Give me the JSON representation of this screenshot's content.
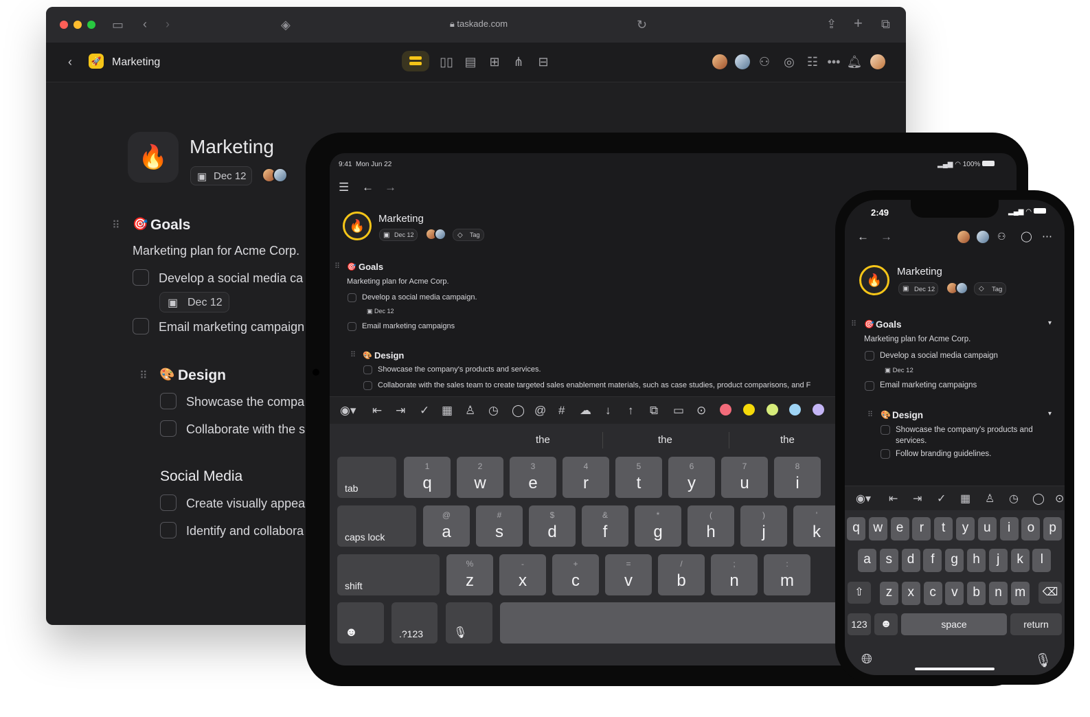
{
  "desktop": {
    "url": "taskade.com",
    "app_title": "Marketing",
    "project": {
      "title": "Marketing",
      "date": "Dec 12"
    },
    "goals": {
      "heading": "Goals",
      "description": "Marketing plan for Acme Corp.",
      "tasks": [
        {
          "label": "Develop a social media ca",
          "date": "Dec 12"
        },
        {
          "label": "Email marketing campaign"
        }
      ]
    },
    "design": {
      "heading": "Design",
      "tasks": [
        {
          "label": "Showcase the compa"
        },
        {
          "label": "Collaborate with the s"
        }
      ]
    },
    "social": {
      "heading": "Social Media",
      "tasks": [
        {
          "label": "Create visually appea"
        },
        {
          "label": "Identify and collabora"
        }
      ]
    }
  },
  "tablet": {
    "status_time": "9:41",
    "status_date": "Mon Jun 22",
    "battery": "100%",
    "project": {
      "title": "Marketing",
      "date": "Dec 12",
      "tag": "Tag"
    },
    "goals": {
      "heading": "Goals",
      "description": "Marketing plan for Acme Corp.",
      "tasks": [
        {
          "label": "Develop a social media campaign.",
          "date": "Dec 12"
        },
        {
          "label": "Email marketing campaigns"
        }
      ]
    },
    "design": {
      "heading": "Design",
      "tasks": [
        {
          "label": "Showcase the company's products and services."
        },
        {
          "label": "Collaborate with the sales team to create targeted sales enablement materials, such as case studies, product comparisons, and F"
        }
      ]
    },
    "toolbar_colors": [
      "#f26b7a",
      "#f5d90a",
      "#d6ec7a",
      "#9ed4f5",
      "#c4b5f5"
    ],
    "suggestions": [
      "the",
      "the",
      "the"
    ],
    "keys": {
      "row1_label": "tab",
      "row1": [
        {
          "sub": "1",
          "main": "q"
        },
        {
          "sub": "2",
          "main": "w"
        },
        {
          "sub": "3",
          "main": "e"
        },
        {
          "sub": "4",
          "main": "r"
        },
        {
          "sub": "5",
          "main": "t"
        },
        {
          "sub": "6",
          "main": "y"
        },
        {
          "sub": "7",
          "main": "u"
        },
        {
          "sub": "8",
          "main": "i"
        }
      ],
      "row2_label": "caps lock",
      "row2": [
        {
          "sub": "@",
          "main": "a"
        },
        {
          "sub": "#",
          "main": "s"
        },
        {
          "sub": "$",
          "main": "d"
        },
        {
          "sub": "&",
          "main": "f"
        },
        {
          "sub": "*",
          "main": "g"
        },
        {
          "sub": "(",
          "main": "h"
        },
        {
          "sub": ")",
          "main": "j"
        },
        {
          "sub": "'",
          "main": "k"
        }
      ],
      "row3_label": "shift",
      "row3": [
        {
          "sub": "%",
          "main": "z"
        },
        {
          "sub": "-",
          "main": "x"
        },
        {
          "sub": "+",
          "main": "c"
        },
        {
          "sub": "=",
          "main": "v"
        },
        {
          "sub": "/",
          "main": "b"
        },
        {
          "sub": ";",
          "main": "n"
        },
        {
          "sub": ":",
          "main": "m"
        }
      ],
      "numbers_label": ".?123"
    }
  },
  "phone": {
    "status_time": "2:49",
    "project": {
      "title": "Marketing",
      "date": "Dec 12",
      "tag": "Tag"
    },
    "goals": {
      "heading": "Goals",
      "description": "Marketing plan for Acme Corp.",
      "tasks": [
        {
          "label": "Develop a social media campaign",
          "date": "Dec 12"
        },
        {
          "label": "Email marketing campaigns"
        }
      ]
    },
    "design": {
      "heading": "Design",
      "tasks": [
        {
          "label": "Showcase the company's products and",
          "label2": "services."
        },
        {
          "label": "Follow branding guidelines."
        }
      ]
    },
    "keys": {
      "row1": [
        "q",
        "w",
        "e",
        "r",
        "t",
        "y",
        "u",
        "i",
        "o",
        "p"
      ],
      "row2": [
        "a",
        "s",
        "d",
        "f",
        "g",
        "h",
        "j",
        "k",
        "l"
      ],
      "row3": [
        "z",
        "x",
        "c",
        "v",
        "b",
        "n",
        "m"
      ],
      "numbers": "123",
      "space": "space",
      "return": "return"
    }
  },
  "colors": {
    "accent": "#f5c518",
    "window_bg": "#1f1f21",
    "key": "#5a5a5e"
  }
}
